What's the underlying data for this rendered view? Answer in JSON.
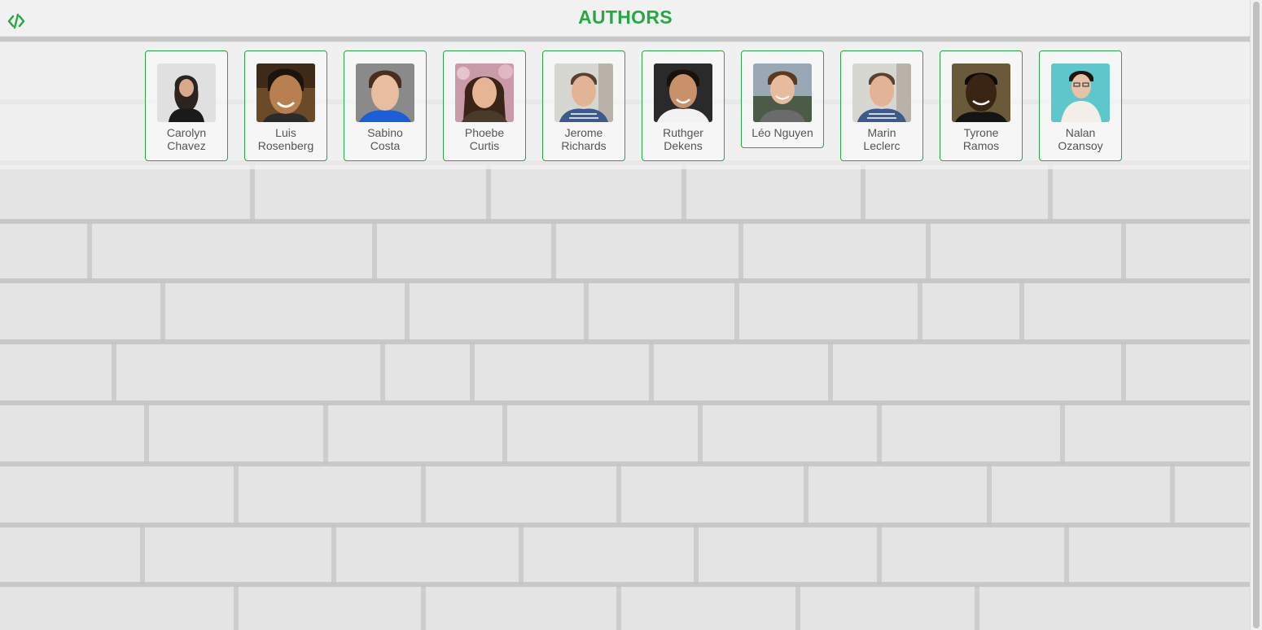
{
  "header": {
    "title": "AUTHORS",
    "logo_icon": "code-icon"
  },
  "colors": {
    "accent": "#28a745",
    "title": "#27a844",
    "text": "#555555"
  },
  "authors": [
    {
      "first": "Carolyn",
      "last": "Chavez"
    },
    {
      "first": "Luis",
      "last": "Rosenberg"
    },
    {
      "first": "Sabino",
      "last": "Costa"
    },
    {
      "first": "Phoebe",
      "last": "Curtis"
    },
    {
      "first": "Jerome",
      "last": "Richards"
    },
    {
      "first": "Ruthger",
      "last": "Dekens"
    },
    {
      "first": "Léo Nguyen",
      "last": ""
    },
    {
      "first": "Marin",
      "last": "Leclerc"
    },
    {
      "first": "Tyrone",
      "last": "Ramos"
    },
    {
      "first": "Nalan",
      "last": "Ozansoy"
    }
  ]
}
